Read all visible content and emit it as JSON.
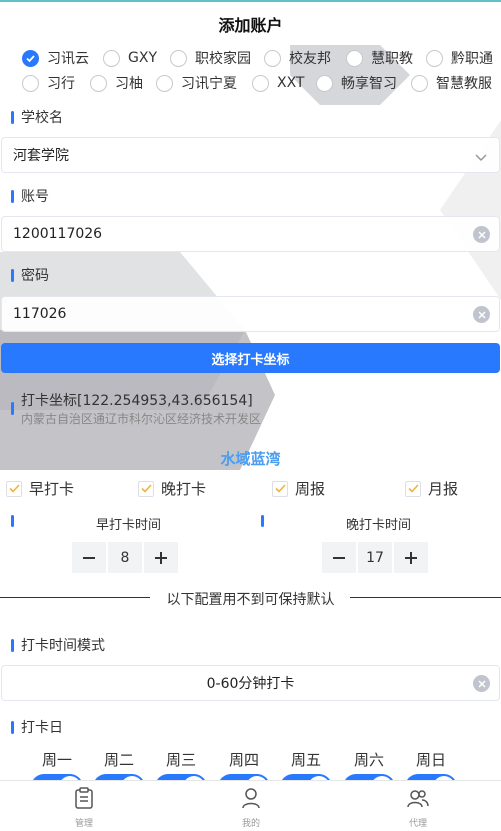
{
  "page_title": "添加账户",
  "platforms": {
    "row1": [
      {
        "label": "习讯云",
        "checked": true
      },
      {
        "label": "GXY",
        "checked": false
      },
      {
        "label": "职校家园",
        "checked": false
      },
      {
        "label": "校友邦",
        "checked": false
      },
      {
        "label": "慧职教",
        "checked": false
      },
      {
        "label": "黔职通",
        "checked": false
      }
    ],
    "row2": [
      {
        "label": "习行",
        "checked": false
      },
      {
        "label": "习柚",
        "checked": false
      },
      {
        "label": "习讯宁夏",
        "checked": false
      },
      {
        "label": "XXT",
        "checked": false
      },
      {
        "label": "畅享智习",
        "checked": false
      },
      {
        "label": "智慧教服",
        "checked": false
      }
    ]
  },
  "school": {
    "label": "学校名",
    "value": "河套学院"
  },
  "account": {
    "label": "账号",
    "value": "1200117026"
  },
  "password": {
    "label": "密码",
    "value": "117026"
  },
  "pick_coord_button": "选择打卡坐标",
  "coordinate": {
    "text": "打卡坐标[122.254953,43.656154]",
    "address": "内蒙古自治区通辽市科尔沁区经济技术开发区"
  },
  "place_name": "水域蓝湾",
  "checks": [
    {
      "label": "早打卡",
      "checked": true
    },
    {
      "label": "晚打卡",
      "checked": true
    },
    {
      "label": "周报",
      "checked": true
    },
    {
      "label": "月报",
      "checked": true
    }
  ],
  "morning": {
    "label": "早打卡时间",
    "value": "8"
  },
  "evening": {
    "label": "晚打卡时间",
    "value": "17"
  },
  "divider_text": "以下配置用不到可保持默认",
  "time_mode": {
    "label": "打卡时间模式",
    "value": "0-60分钟打卡"
  },
  "days": {
    "label": "打卡日",
    "names": [
      "周一",
      "周二",
      "周三",
      "周四",
      "周五",
      "周六",
      "周日"
    ],
    "enabled": [
      true,
      true,
      true,
      true,
      true,
      true,
      true
    ]
  },
  "tabs": [
    {
      "label": "管理",
      "icon": "clipboard-icon"
    },
    {
      "label": "我的",
      "icon": "user-icon"
    },
    {
      "label": "代理",
      "icon": "group-icon"
    }
  ],
  "colors": {
    "accent": "#2979ff",
    "place_name": "#4a9df0",
    "check": "#f0b33c"
  }
}
